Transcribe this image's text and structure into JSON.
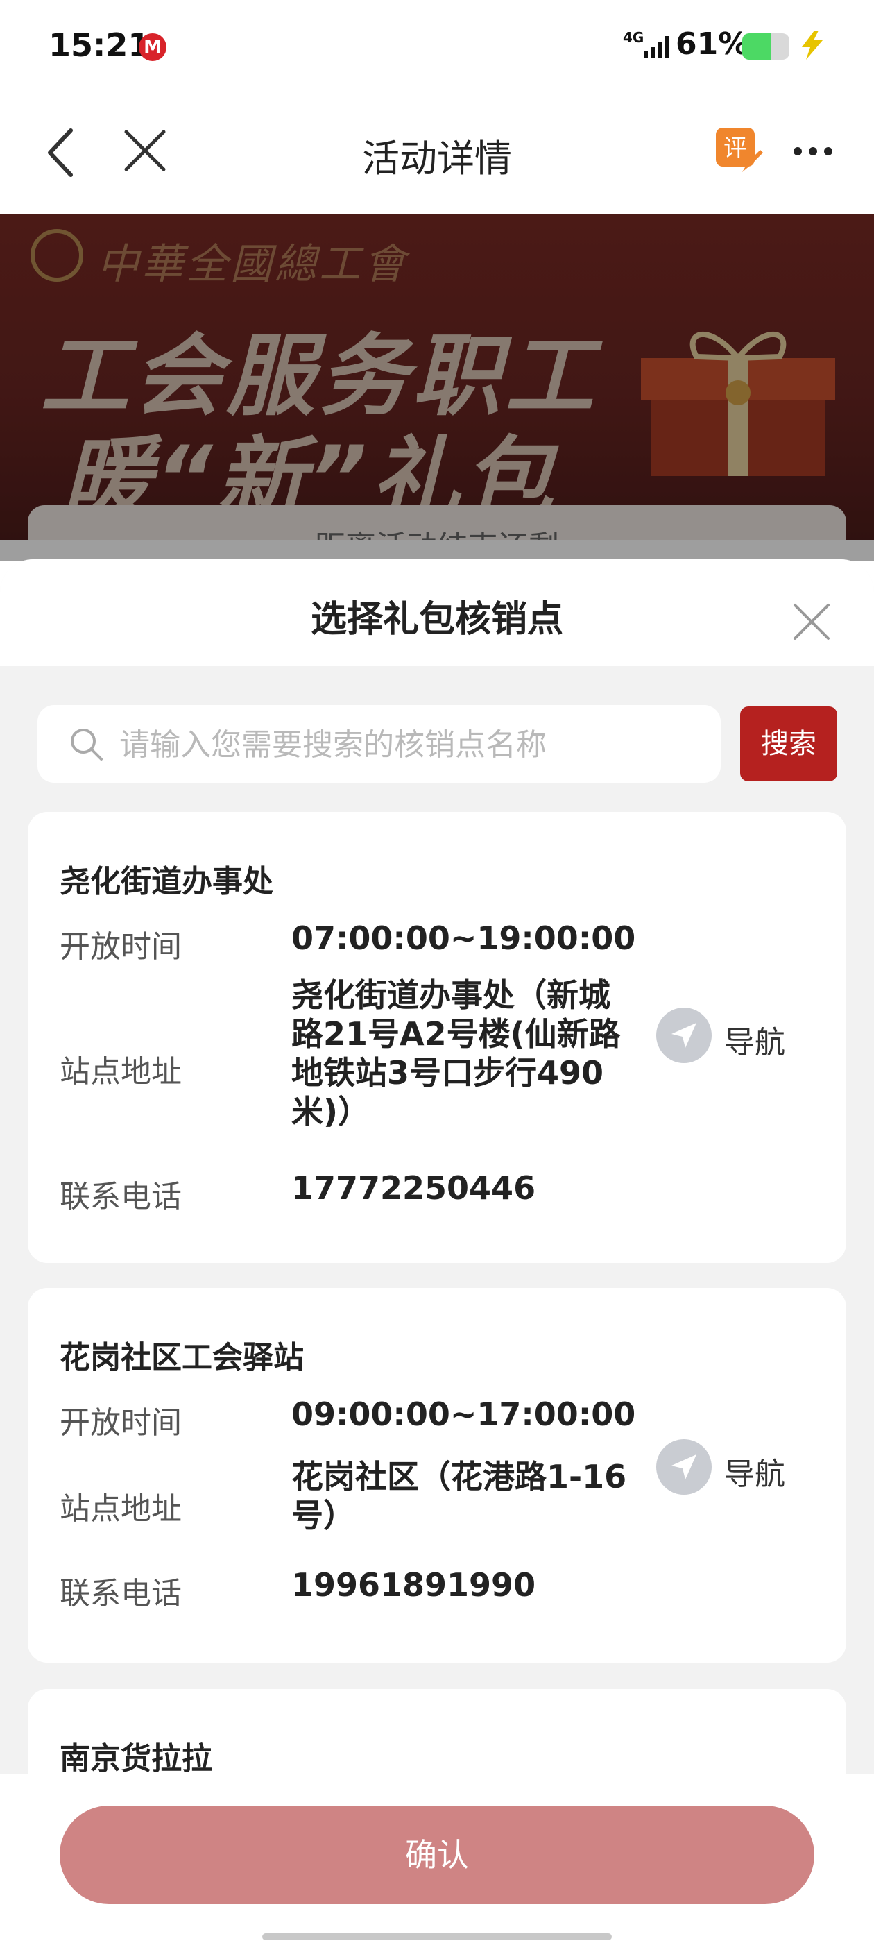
{
  "status_bar": {
    "time": "15:21",
    "network": "4G",
    "battery": "61%",
    "battery_level": 0.61
  },
  "nav": {
    "title": "活动详情",
    "rate_label": "评"
  },
  "banner": {
    "brand": "中華全國總工會",
    "headline1": "工会服务职工",
    "headline2": "暖“新”礼包",
    "notice": "距离活动结束还剩"
  },
  "sheet": {
    "title": "选择礼包核销点",
    "search": {
      "placeholder": "请输入您需要搜索的核销点名称",
      "value": "",
      "button": "搜索"
    },
    "labels": {
      "hours": "开放时间",
      "address": "站点地址",
      "phone": "联系电话",
      "navigate": "导航"
    },
    "stations": [
      {
        "name": "尧化街道办事处",
        "hours": "07:00:00~19:00:00",
        "address_lines": [
          "尧化街道办事处（新城",
          "路21号A2号楼(仙新路",
          "地铁站3号口步行490",
          "米)）"
        ],
        "phone": "17772250446"
      },
      {
        "name": "花岗社区工会驿站",
        "hours": "09:00:00~17:00:00",
        "address_lines": [
          "花岗社区（花港路1-16",
          "号）"
        ],
        "phone": "19961891990"
      },
      {
        "name": "南京货拉拉"
      }
    ]
  },
  "footer": {
    "confirm": "确认"
  }
}
